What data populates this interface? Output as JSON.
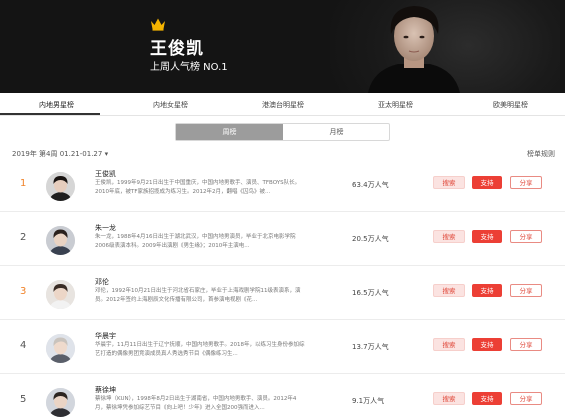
{
  "hero": {
    "name": "王俊凯",
    "subtitle": "上周人气榜 NO.1"
  },
  "tabs": [
    {
      "label": "内地男星榜",
      "active": true
    },
    {
      "label": "内地女星榜",
      "active": false
    },
    {
      "label": "港澳台明星榜",
      "active": false
    },
    {
      "label": "亚太明星榜",
      "active": false
    },
    {
      "label": "欧美明星榜",
      "active": false
    }
  ],
  "toggle": {
    "week_label": "周榜",
    "month_label": "月榜",
    "selected": "周榜"
  },
  "period": "2019年 第4周 01.21-01.27",
  "period_arrow": "▾",
  "rules_label": "榜单规则",
  "rankings": [
    {
      "rank": "1",
      "name": "王俊凯",
      "description": "王俊凯，1999年9月21日出生于中国重庆，中国内地男歌手、演员、TFBOYS队长。2010年底，被TF家族招揽成为练习生。2012年2月，翻唱《囚鸟》被...",
      "popularity": "63.4万人气",
      "search_label": "搜索",
      "vote_label": "支持",
      "share_label": "分享"
    },
    {
      "rank": "2",
      "name": "朱一龙",
      "description": "朱一龙，1988年4月16日出生于湖北武汉，中国内地男演员，毕业于北京电影学院2006级表演本科。2009年出演剧《男生缘》；2010年主演电...",
      "popularity": "20.5万人气",
      "search_label": "搜索",
      "vote_label": "支持",
      "share_label": "分享"
    },
    {
      "rank": "3",
      "name": "邓伦",
      "description": "邓伦，1992年10月21日出生于河北省石家庄，毕业于上海戏剧学院11级表演系，演员。2012年签约上海剧辰文化传播有限公司，首参演电视剧《花...",
      "popularity": "16.5万人气",
      "search_label": "搜索",
      "vote_label": "支持",
      "share_label": "分享"
    },
    {
      "rank": "4",
      "name": "华晨宇",
      "description": "华晨宇，11月11日出生于辽宁抚顺，中国内地男歌手。2018年，以练习生身份参加综艺打造的偶像男团竞演成员真人秀选秀节目《偶像练习生...",
      "popularity": "13.7万人气",
      "search_label": "搜索",
      "vote_label": "支持",
      "share_label": "分享"
    },
    {
      "rank": "5",
      "name": "蔡徐坤",
      "description": "蔡徐坤（KUN），1998年8月2日出生于湖南省，中国内地男歌手、演员。2012年4月，蔡徐坤凭参加综艺节目《向上吧！少年》进入全国200强而进入...",
      "popularity": "9.1万人气",
      "search_label": "搜索",
      "vote_label": "支持",
      "share_label": "分享"
    }
  ],
  "colors": {
    "hero_bg": "#141414",
    "crown": "#f5b400",
    "rank_top": "#f0832a",
    "vote_red": "#ec3f35",
    "search_bg": "#fbe3e1"
  }
}
